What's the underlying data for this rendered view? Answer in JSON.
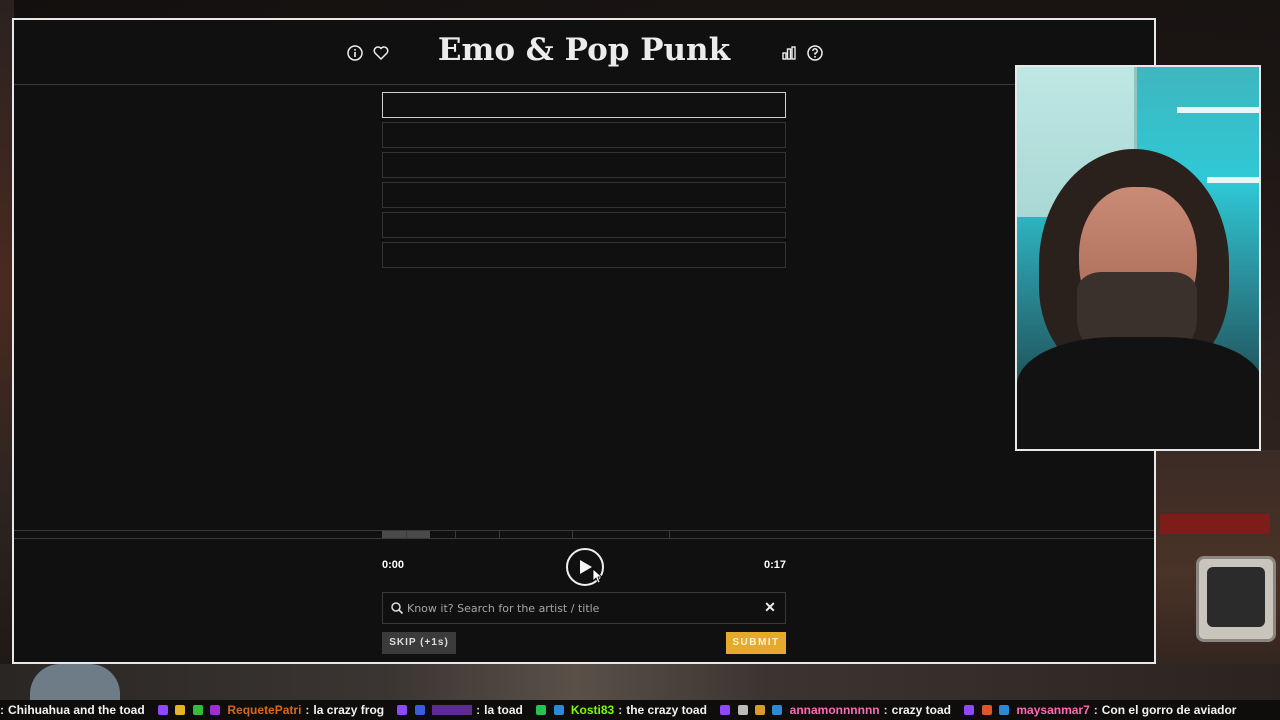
{
  "game": {
    "title": "Emo & Pop Punk",
    "header_icons_left": [
      "info-icon",
      "heart-icon"
    ],
    "header_icons_right": [
      "stats-icon",
      "help-icon"
    ],
    "guess_slots": [
      "",
      "",
      "",
      "",
      "",
      ""
    ],
    "progress": {
      "filled_fraction": 0.12,
      "segment_marks": [
        0.06,
        0.18,
        0.29,
        0.47,
        0.71
      ]
    },
    "time_start": "0:00",
    "time_end": "0:17",
    "search_placeholder": "Know it? Search for the artist / title",
    "skip_label": "SKIP (+1s)",
    "submit_label": "SUBMIT",
    "colors": {
      "background": "#101010",
      "submit": "#e4a92d",
      "skip": "#3b3b3b"
    }
  },
  "chat": [
    {
      "user": "",
      "text": "Chihuahua and the toad",
      "user_color": "#ffffff"
    },
    {
      "user": "RequetePatri",
      "text": "la crazy frog",
      "user_color": "#d2691e"
    },
    {
      "user": "",
      "text": "la toad",
      "user_color": "#8a2be2"
    },
    {
      "user": "Kosti83",
      "text": "the crazy toad",
      "user_color": "#7cfc00"
    },
    {
      "user": "annamonnnnnn",
      "text": "crazy toad",
      "user_color": "#ff69b4"
    },
    {
      "user": "maysanmar7",
      "text": "Con el gorro de aviador",
      "user_color": "#ff69b4"
    }
  ]
}
